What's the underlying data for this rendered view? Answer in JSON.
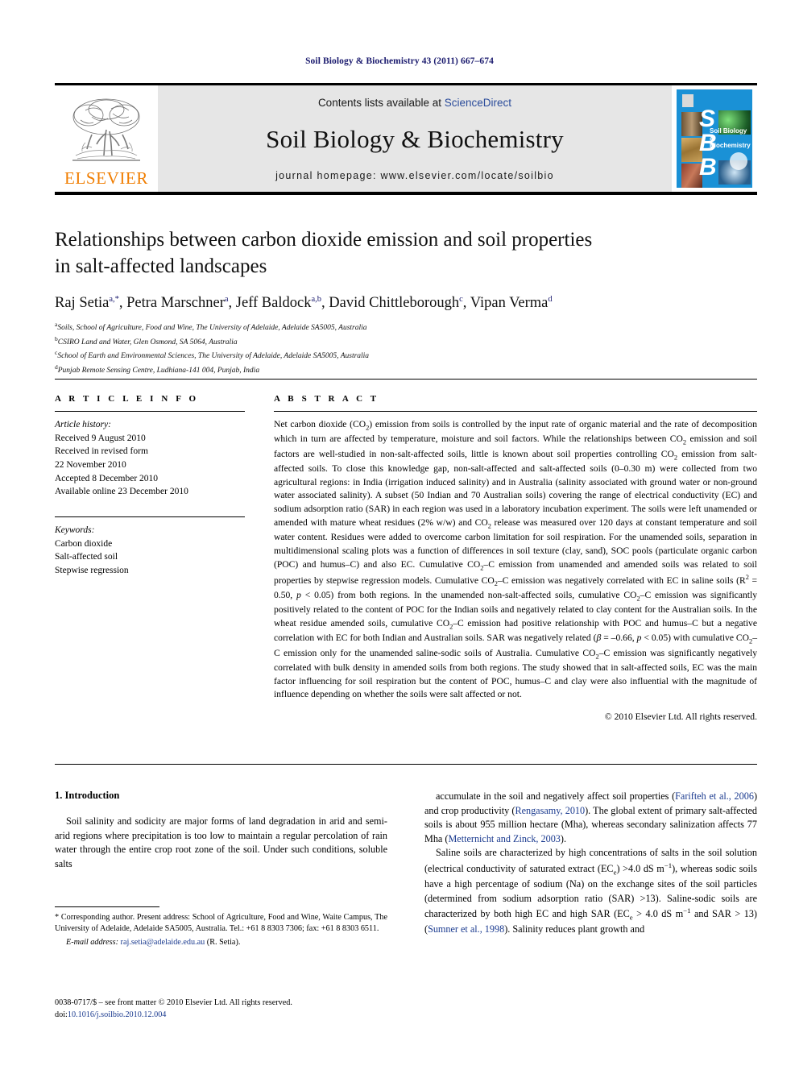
{
  "running_head": "Soil Biology & Biochemistry 43 (2011) 667–674",
  "masthead": {
    "contents_prefix": "Contents lists available at ",
    "sciencedirect": "ScienceDirect",
    "journal_title": "Soil Biology & Biochemistry",
    "homepage": "journal homepage: www.elsevier.com/locate/soilbio",
    "publisher_name": "ELSEVIER",
    "cover": {
      "letters": [
        "S",
        "B",
        "B"
      ],
      "title": "Soil Biology & Biochemistry"
    }
  },
  "article": {
    "title_line1": "Relationships between carbon dioxide emission and soil properties",
    "title_line2": "in salt-affected landscapes",
    "authors_html": "Raj Setia<sup>a,*</sup>, Petra Marschner<sup>a</sup>, Jeff Baldock<sup>a,b</sup>, David Chittleborough<sup>c</sup>, Vipan Verma<sup>d</sup>",
    "affiliations": [
      "Soils, School of Agriculture, Food and Wine, The University of Adelaide, Adelaide SA5005, Australia",
      "CSIRO Land and Water, Glen Osmond, SA 5064, Australia",
      "School of Earth and Environmental Sciences, The University of Adelaide, Adelaide SA5005, Australia",
      "Punjab Remote Sensing Centre, Ludhiana-141 004, Punjab, India"
    ],
    "affiliation_marks": [
      "a",
      "b",
      "c",
      "d"
    ]
  },
  "info": {
    "heading": "A R T I C L E  I N F O",
    "history_label": "Article history:",
    "history": [
      "Received 9 August 2010",
      "Received in revised form",
      "22 November 2010",
      "Accepted 8 December 2010",
      "Available online 23 December 2010"
    ],
    "keywords_label": "Keywords:",
    "keywords": [
      "Carbon dioxide",
      "Salt-affected soil",
      "Stepwise regression"
    ]
  },
  "abstract": {
    "heading": "A B S T R A C T",
    "body_html": "Net carbon dioxide (CO<sub>2</sub>) emission from soils is controlled by the input rate of organic material and the rate of decomposition which in turn are affected by temperature, moisture and soil factors. While the relationships between CO<sub>2</sub> emission and soil factors are well-studied in non-salt-affected soils, little is known about soil properties controlling CO<sub>2</sub> emission from salt-affected soils. To close this knowledge gap, non-salt-affected and salt-affected soils (0&ndash;0.30 m) were collected from two agricultural regions: in India (irrigation induced salinity) and in Australia (salinity associated with ground water or non-ground water associated salinity). A subset (50 Indian and 70 Australian soils) covering the range of electrical conductivity (EC) and sodium adsorption ratio (SAR) in each region was used in a laboratory incubation experiment. The soils were left unamended or amended with mature wheat residues (2% w/w) and CO<sub>2</sub> release was measured over 120 days at constant temperature and soil water content. Residues were added to overcome carbon limitation for soil respiration. For the unamended soils, separation in multidimensional scaling plots was a function of differences in soil texture (clay, sand), SOC pools (particulate organic carbon (POC) and humus&ndash;C) and also EC. Cumulative CO<sub>2</sub>&ndash;C emission from unamended and amended soils was related to soil properties by stepwise regression models. Cumulative CO<sub>2</sub>&ndash;C emission was negatively correlated with EC in saline soils (R<sup class=\"num\">2</sup> = 0.50, <i>p</i> &lt; 0.05) from both regions. In the unamended non-salt-affected soils, cumulative CO<sub>2</sub>&ndash;C emission was significantly positively related to the content of POC for the Indian soils and negatively related to clay content for the Australian soils. In the wheat residue amended soils, cumulative CO<sub>2</sub>&ndash;C emission had positive relationship with POC and humus&ndash;C but a negative correlation with EC for both Indian and Australian soils. SAR was negatively related (<i>&beta;</i> = &ndash;0.66, <i>p</i> &lt; 0.05) with cumulative CO<sub>2</sub>&ndash;C emission only for the unamended saline-sodic soils of Australia. Cumulative CO<sub>2</sub>&ndash;C emission was significantly negatively correlated with bulk density in amended soils from both regions. The study showed that in salt-affected soils, EC was the main factor influencing for soil respiration but the content of POC, humus&ndash;C and clay were also influential with the magnitude of influence depending on whether the soils were salt affected or not.",
    "copyright": "© 2010 Elsevier Ltd. All rights reserved."
  },
  "body": {
    "intro_heading": "1.  Introduction",
    "left_paragraph": "Soil salinity and sodicity are major forms of land degradation in arid and semi-arid regions where precipitation is too low to maintain a regular percolation of rain water through the entire crop root zone of the soil. Under such conditions, soluble salts",
    "right_paragraph_1_html": "accumulate in the soil and negatively affect soil properties (<span class=\"ref\">Farifteh et al., 2006</span>) and crop productivity (<span class=\"ref\">Rengasamy, 2010</span>). The global extent of primary salt-affected soils is about 955 million hectare (Mha), whereas secondary salinization affects 77 Mha (<span class=\"ref\">Metternicht and Zinck, 2003</span>).",
    "right_paragraph_2_html": "Saline soils are characterized by high concentrations of salts in the soil solution (electrical conductivity of saturated extract (EC<sub>e</sub>) &gt;4.0 dS m<sup class=\"num\">&minus;1</sup>), whereas sodic soils have a high percentage of sodium (Na) on the exchange sites of the soil particles (determined from sodium adsorption ratio (SAR) &gt;13). Saline-sodic soils are characterized by both high EC and high SAR (EC<sub>e</sub> &gt; 4.0 dS m<sup class=\"num\">&minus;1</sup> and SAR &gt; 13) (<span class=\"ref\">Sumner et al., 1998</span>). Salinity reduces plant growth and"
  },
  "footnotes": {
    "corresponding_html": "* Corresponding author. Present address: School of Agriculture, Food and Wine, Waite Campus, The University of Adelaide, Adelaide SA5005, Australia. Tel.: +61 8 8303 7306; fax: +61 8 8303 6511.",
    "email_label": "E-mail address:",
    "email": "raj.setia@adelaide.edu.au",
    "email_suffix": "(R. Setia).",
    "imprint_html": "0038-0717/$ &ndash; see front matter &copy; 2010 Elsevier Ltd. All rights reserved.",
    "doi_label": "doi:",
    "doi": "10.1016/j.soilbio.2010.12.004"
  },
  "colors": {
    "link": "#1a3a8f",
    "header_blue": "#1a1a6e",
    "elsevier_orange": "#f07d00",
    "cover_blue": "#1a91d6",
    "masthead_gray": "#e6e6e6"
  }
}
